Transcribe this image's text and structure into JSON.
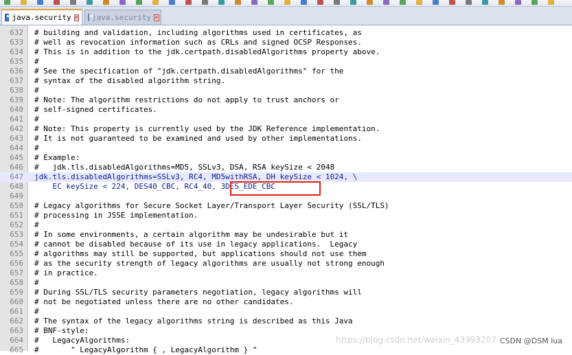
{
  "tabs": [
    {
      "label": "java.security",
      "active": true
    },
    {
      "label": "java.security",
      "active": false
    }
  ],
  "lines": [
    {
      "n": "632",
      "t": "# building and validation, including algorithms used in certificates, as"
    },
    {
      "n": "633",
      "t": "# well as revocation information such as CRLs and signed OCSP Responses."
    },
    {
      "n": "634",
      "t": "# This is in addition to the jdk.certpath.disabledAlgorithms property above."
    },
    {
      "n": "635",
      "t": "#"
    },
    {
      "n": "636",
      "t": "# See the specification of \"jdk.certpath.disabledAlgorithms\" for the"
    },
    {
      "n": "637",
      "t": "# syntax of the disabled algorithm string."
    },
    {
      "n": "638",
      "t": "#"
    },
    {
      "n": "639",
      "t": "# Note: The algorithm restrictions do not apply to trust anchors or"
    },
    {
      "n": "640",
      "t": "# self-signed certificates."
    },
    {
      "n": "641",
      "t": "#"
    },
    {
      "n": "642",
      "t": "# Note: This property is currently used by the JDK Reference implementation."
    },
    {
      "n": "643",
      "t": "# It is not guaranteed to be examined and used by other implementations."
    },
    {
      "n": "644",
      "t": "#"
    },
    {
      "n": "645",
      "t": "# Example:"
    },
    {
      "n": "646",
      "t": "#   jdk.tls.disabledAlgorithms=MD5, SSLv3, DSA, RSA keySize < 2048"
    },
    {
      "n": "647",
      "t": "jdk.tls.disabledAlgorithms=SSLv3, RC4, MD5withRSA, DH keySize < 1024, \\"
    },
    {
      "n": "648",
      "t": "    EC keySize < 224, DES40_CBC, RC4_40, 3DES_EDE_CBC"
    },
    {
      "n": "649",
      "t": ""
    },
    {
      "n": "650",
      "t": "# Legacy algorithms for Secure Socket Layer/Transport Layer Security (SSL/TLS)"
    },
    {
      "n": "651",
      "t": "# processing in JSSE implementation."
    },
    {
      "n": "652",
      "t": "#"
    },
    {
      "n": "653",
      "t": "# In some environments, a certain algorithm may be undesirable but it"
    },
    {
      "n": "654",
      "t": "# cannot be disabled because of its use in legacy applications.  Legacy"
    },
    {
      "n": "655",
      "t": "# algorithms may still be supported, but applications should not use them"
    },
    {
      "n": "656",
      "t": "# as the security strength of legacy algorithms are usually not strong enough"
    },
    {
      "n": "657",
      "t": "# in practice."
    },
    {
      "n": "658",
      "t": "#"
    },
    {
      "n": "659",
      "t": "# During SSL/TLS security parameters negotiation, legacy algorithms will"
    },
    {
      "n": "660",
      "t": "# not be negotiated unless there are no other candidates."
    },
    {
      "n": "661",
      "t": "#"
    },
    {
      "n": "662",
      "t": "# The syntax of the legacy algorithms string is described as this Java"
    },
    {
      "n": "663",
      "t": "# BNF-style:"
    },
    {
      "n": "664",
      "t": "#   LegacyAlgorithms:"
    },
    {
      "n": "665",
      "t": "#       \" LegacyAlgorithm { , LegacyAlgorithm } \""
    }
  ],
  "current_line": "647",
  "watermark": "https://blog.csdn.net/weixin_43993207",
  "csdn_credit": "CSDN @DSM lua",
  "colors": {
    "accent_tab": "#f2a23a",
    "highlight_box": "#e0201a",
    "current_line_bg": "#e8e8ff"
  }
}
